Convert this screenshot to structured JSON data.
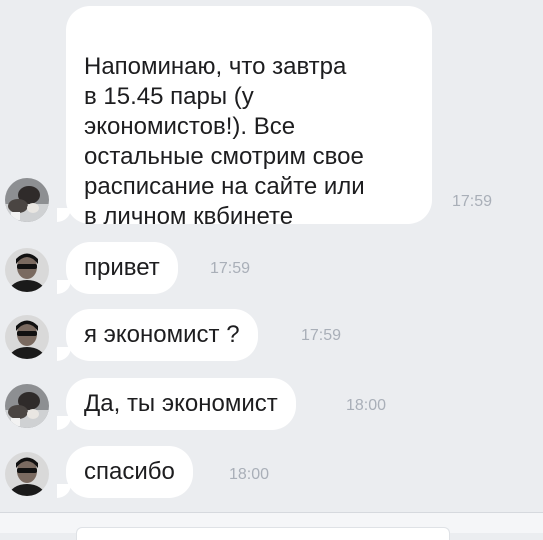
{
  "messages": [
    {
      "sender": "group-member",
      "text": "Напоминаю,  что завтра\nв 15.45 пары (у\nэкономистов!).  Все\nостальные смотрим свое\nрасписание на сайте или\nв личном квбинете",
      "time": "17:59"
    },
    {
      "sender": "user",
      "text": "привет",
      "time": "17:59"
    },
    {
      "sender": "user",
      "text": "я экономист ?",
      "time": "17:59"
    },
    {
      "sender": "group-member",
      "text": "Да, ты экономист",
      "time": "18:00"
    },
    {
      "sender": "user",
      "text": "спасибо",
      "time": "18:00"
    }
  ],
  "composer": {
    "placeholder": ""
  },
  "colors": {
    "background": "#ebedf0",
    "bubble": "#ffffff",
    "time": "#a9afb8"
  }
}
